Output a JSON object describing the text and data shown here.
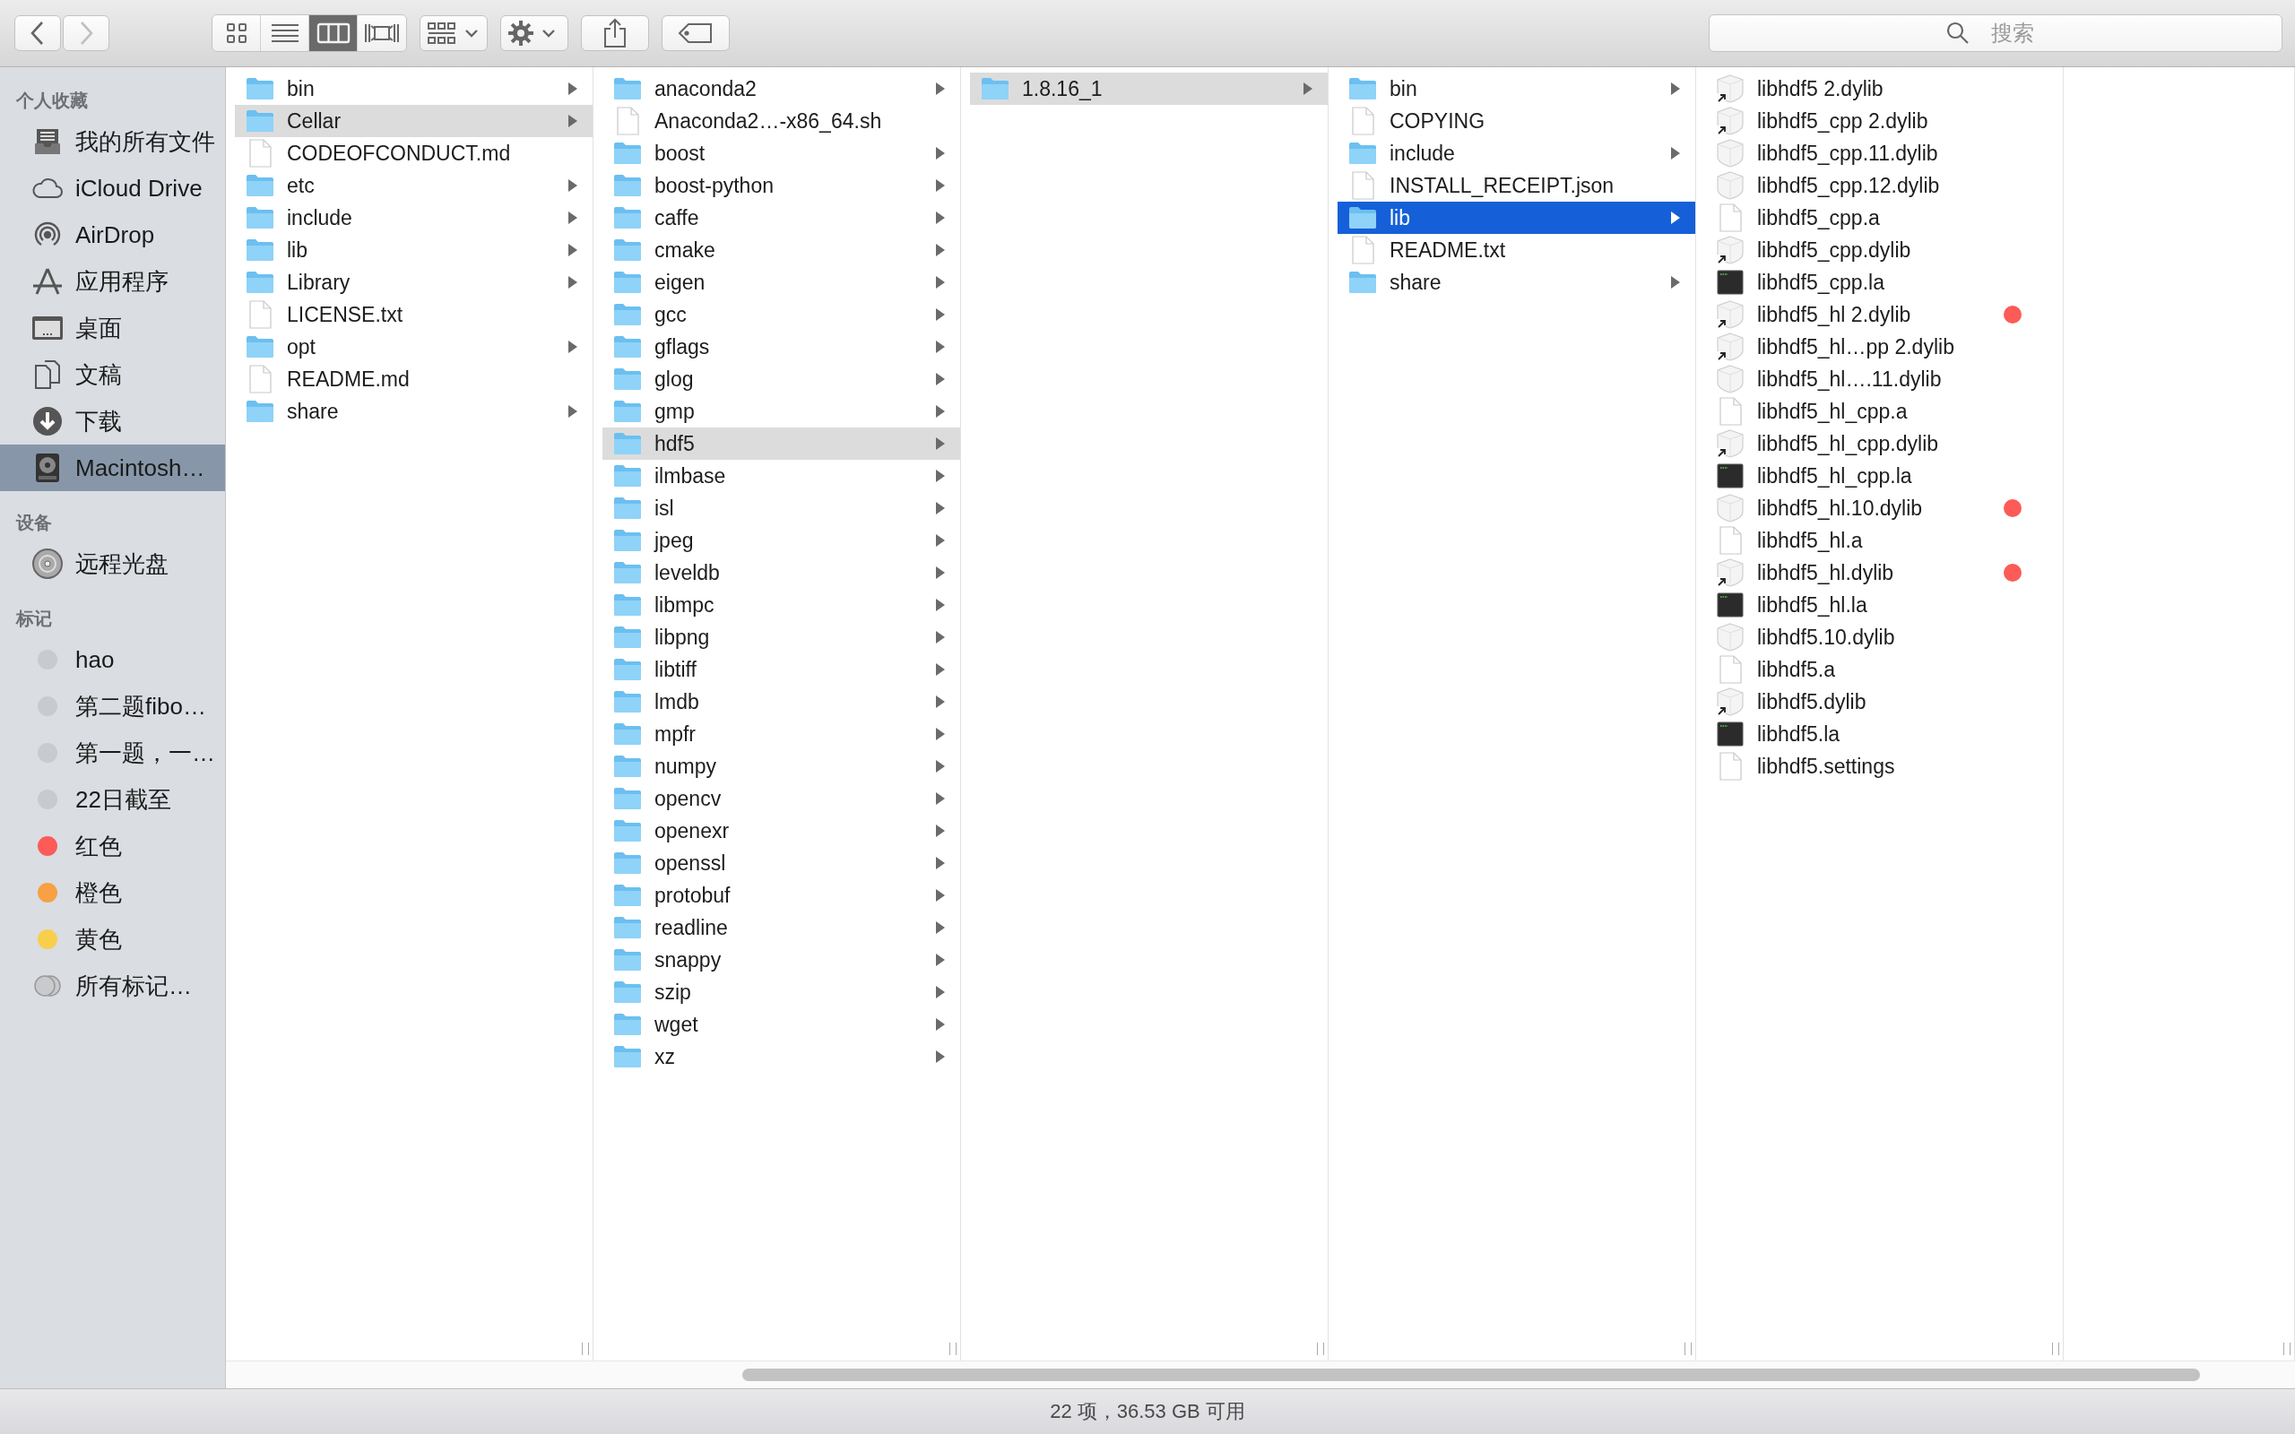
{
  "toolbar": {
    "back": {
      "disabled": false
    },
    "forward": {
      "disabled": true
    },
    "view_modes": [
      {
        "kind": "icons",
        "selected": false
      },
      {
        "kind": "list",
        "selected": false
      },
      {
        "kind": "columns",
        "selected": true
      },
      {
        "kind": "coverflow",
        "selected": false
      }
    ],
    "search": {
      "placeholder": "搜索"
    }
  },
  "sidebar": {
    "sections": [
      {
        "heading": "个人收藏",
        "items": [
          {
            "kind": "all-files",
            "label": "我的所有文件",
            "selected": false
          },
          {
            "kind": "cloud",
            "label": "iCloud Drive",
            "selected": false
          },
          {
            "kind": "airdrop",
            "label": "AirDrop",
            "selected": false
          },
          {
            "kind": "apps",
            "label": "应用程序",
            "selected": false
          },
          {
            "kind": "desktop",
            "label": "桌面",
            "selected": false
          },
          {
            "kind": "documents",
            "label": "文稿",
            "selected": false
          },
          {
            "kind": "downloads",
            "label": "下载",
            "selected": false
          },
          {
            "kind": "disk",
            "label": "Macintosh…",
            "selected": true
          }
        ]
      },
      {
        "heading": "设备",
        "items": [
          {
            "kind": "optical",
            "label": "远程光盘",
            "selected": false
          }
        ]
      },
      {
        "heading": "标记",
        "items": [
          {
            "kind": "tag",
            "label": "hao",
            "selected": false,
            "color": "#c9cacd"
          },
          {
            "kind": "tag",
            "label": "第二题fibo…",
            "selected": false,
            "color": "#c9cacd"
          },
          {
            "kind": "tag",
            "label": "第一题，一…",
            "selected": false,
            "color": "#c9cacd"
          },
          {
            "kind": "tag",
            "label": "22日截至",
            "selected": false,
            "color": "#c9cacd"
          },
          {
            "kind": "tag",
            "label": "红色",
            "selected": false,
            "color": "#fc5b57"
          },
          {
            "kind": "tag",
            "label": "橙色",
            "selected": false,
            "color": "#f7a044"
          },
          {
            "kind": "tag",
            "label": "黄色",
            "selected": false,
            "color": "#f8cf4a"
          },
          {
            "kind": "all-tags",
            "label": "所有标记…",
            "selected": false
          }
        ]
      }
    ]
  },
  "columns": [
    {
      "focused": false,
      "items": [
        {
          "name": "bin",
          "kind": "folder",
          "has_children": true,
          "selected": false
        },
        {
          "name": "Cellar",
          "kind": "folder",
          "has_children": true,
          "selected": true
        },
        {
          "name": "CODEOFCONDUCT.md",
          "kind": "document",
          "has_children": false,
          "selected": false
        },
        {
          "name": "etc",
          "kind": "folder",
          "has_children": true,
          "selected": false
        },
        {
          "name": "include",
          "kind": "folder",
          "has_children": true,
          "selected": false
        },
        {
          "name": "lib",
          "kind": "folder",
          "has_children": true,
          "selected": false
        },
        {
          "name": "Library",
          "kind": "folder",
          "has_children": true,
          "selected": false
        },
        {
          "name": "LICENSE.txt",
          "kind": "document",
          "has_children": false,
          "selected": false
        },
        {
          "name": "opt",
          "kind": "folder",
          "has_children": true,
          "selected": false
        },
        {
          "name": "README.md",
          "kind": "document",
          "has_children": false,
          "selected": false
        },
        {
          "name": "share",
          "kind": "folder",
          "has_children": true,
          "selected": false
        }
      ]
    },
    {
      "focused": false,
      "items": [
        {
          "name": "anaconda2",
          "kind": "folder",
          "has_children": true,
          "selected": false
        },
        {
          "name": "Anaconda2…-x86_64.sh",
          "kind": "document",
          "has_children": false,
          "selected": false
        },
        {
          "name": "boost",
          "kind": "folder",
          "has_children": true,
          "selected": false
        },
        {
          "name": "boost-python",
          "kind": "folder",
          "has_children": true,
          "selected": false
        },
        {
          "name": "caffe",
          "kind": "folder",
          "has_children": true,
          "selected": false
        },
        {
          "name": "cmake",
          "kind": "folder",
          "has_children": true,
          "selected": false
        },
        {
          "name": "eigen",
          "kind": "folder",
          "has_children": true,
          "selected": false
        },
        {
          "name": "gcc",
          "kind": "folder",
          "has_children": true,
          "selected": false
        },
        {
          "name": "gflags",
          "kind": "folder",
          "has_children": true,
          "selected": false
        },
        {
          "name": "glog",
          "kind": "folder",
          "has_children": true,
          "selected": false
        },
        {
          "name": "gmp",
          "kind": "folder",
          "has_children": true,
          "selected": false
        },
        {
          "name": "hdf5",
          "kind": "folder",
          "has_children": true,
          "selected": true
        },
        {
          "name": "ilmbase",
          "kind": "folder",
          "has_children": true,
          "selected": false
        },
        {
          "name": "isl",
          "kind": "folder",
          "has_children": true,
          "selected": false
        },
        {
          "name": "jpeg",
          "kind": "folder",
          "has_children": true,
          "selected": false
        },
        {
          "name": "leveldb",
          "kind": "folder",
          "has_children": true,
          "selected": false
        },
        {
          "name": "libmpc",
          "kind": "folder",
          "has_children": true,
          "selected": false
        },
        {
          "name": "libpng",
          "kind": "folder",
          "has_children": true,
          "selected": false
        },
        {
          "name": "libtiff",
          "kind": "folder",
          "has_children": true,
          "selected": false
        },
        {
          "name": "lmdb",
          "kind": "folder",
          "has_children": true,
          "selected": false
        },
        {
          "name": "mpfr",
          "kind": "folder",
          "has_children": true,
          "selected": false
        },
        {
          "name": "numpy",
          "kind": "folder",
          "has_children": true,
          "selected": false
        },
        {
          "name": "opencv",
          "kind": "folder",
          "has_children": true,
          "selected": false
        },
        {
          "name": "openexr",
          "kind": "folder",
          "has_children": true,
          "selected": false
        },
        {
          "name": "openssl",
          "kind": "folder",
          "has_children": true,
          "selected": false
        },
        {
          "name": "protobuf",
          "kind": "folder",
          "has_children": true,
          "selected": false
        },
        {
          "name": "readline",
          "kind": "folder",
          "has_children": true,
          "selected": false
        },
        {
          "name": "snappy",
          "kind": "folder",
          "has_children": true,
          "selected": false
        },
        {
          "name": "szip",
          "kind": "folder",
          "has_children": true,
          "selected": false
        },
        {
          "name": "wget",
          "kind": "folder",
          "has_children": true,
          "selected": false
        },
        {
          "name": "xz",
          "kind": "folder",
          "has_children": true,
          "selected": false
        }
      ]
    },
    {
      "focused": false,
      "items": [
        {
          "name": "1.8.16_1",
          "kind": "folder",
          "has_children": true,
          "selected": true
        }
      ]
    },
    {
      "focused": true,
      "items": [
        {
          "name": "bin",
          "kind": "folder",
          "has_children": true,
          "selected": false
        },
        {
          "name": "COPYING",
          "kind": "document",
          "has_children": false,
          "selected": false
        },
        {
          "name": "include",
          "kind": "folder",
          "has_children": true,
          "selected": false
        },
        {
          "name": "INSTALL_RECEIPT.json",
          "kind": "document",
          "has_children": false,
          "selected": false
        },
        {
          "name": "lib",
          "kind": "folder",
          "has_children": true,
          "selected": true
        },
        {
          "name": "README.txt",
          "kind": "document",
          "has_children": false,
          "selected": false
        },
        {
          "name": "share",
          "kind": "folder",
          "has_children": true,
          "selected": false
        }
      ]
    },
    {
      "items": [
        {
          "name": "libhdf5 2.dylib",
          "kind": "library-alias",
          "has_children": false,
          "selected": false
        },
        {
          "name": "libhdf5_cpp 2.dylib",
          "kind": "library-alias",
          "has_children": false,
          "selected": false
        },
        {
          "name": "libhdf5_cpp.11.dylib",
          "kind": "library",
          "has_children": false,
          "selected": false
        },
        {
          "name": "libhdf5_cpp.12.dylib",
          "kind": "library",
          "has_children": false,
          "selected": false
        },
        {
          "name": "libhdf5_cpp.a",
          "kind": "document",
          "has_children": false,
          "selected": false
        },
        {
          "name": "libhdf5_cpp.dylib",
          "kind": "library-alias",
          "has_children": false,
          "selected": false
        },
        {
          "name": "libhdf5_cpp.la",
          "kind": "executable",
          "has_children": false,
          "selected": false
        },
        {
          "name": "libhdf5_hl 2.dylib",
          "kind": "library-alias",
          "has_children": false,
          "selected": false,
          "color": "#fc5b57"
        },
        {
          "name": "libhdf5_hl…pp 2.dylib",
          "kind": "library-alias",
          "has_children": false,
          "selected": false
        },
        {
          "name": "libhdf5_hl….11.dylib",
          "kind": "library",
          "has_children": false,
          "selected": false
        },
        {
          "name": "libhdf5_hl_cpp.a",
          "kind": "document",
          "has_children": false,
          "selected": false
        },
        {
          "name": "libhdf5_hl_cpp.dylib",
          "kind": "library-alias",
          "has_children": false,
          "selected": false
        },
        {
          "name": "libhdf5_hl_cpp.la",
          "kind": "executable",
          "has_children": false,
          "selected": false
        },
        {
          "name": "libhdf5_hl.10.dylib",
          "kind": "library",
          "has_children": false,
          "selected": false,
          "color": "#fc5b57"
        },
        {
          "name": "libhdf5_hl.a",
          "kind": "document",
          "has_children": false,
          "selected": false
        },
        {
          "name": "libhdf5_hl.dylib",
          "kind": "library-alias",
          "has_children": false,
          "selected": false,
          "color": "#fc5b57"
        },
        {
          "name": "libhdf5_hl.la",
          "kind": "executable",
          "has_children": false,
          "selected": false
        },
        {
          "name": "libhdf5.10.dylib",
          "kind": "library",
          "has_children": false,
          "selected": false
        },
        {
          "name": "libhdf5.a",
          "kind": "document",
          "has_children": false,
          "selected": false
        },
        {
          "name": "libhdf5.dylib",
          "kind": "library-alias",
          "has_children": false,
          "selected": false
        },
        {
          "name": "libhdf5.la",
          "kind": "executable",
          "has_children": false,
          "selected": false
        },
        {
          "name": "libhdf5.settings",
          "kind": "document",
          "has_children": false,
          "selected": false
        }
      ]
    }
  ],
  "status_bar": "22 项，36.53 GB 可用"
}
